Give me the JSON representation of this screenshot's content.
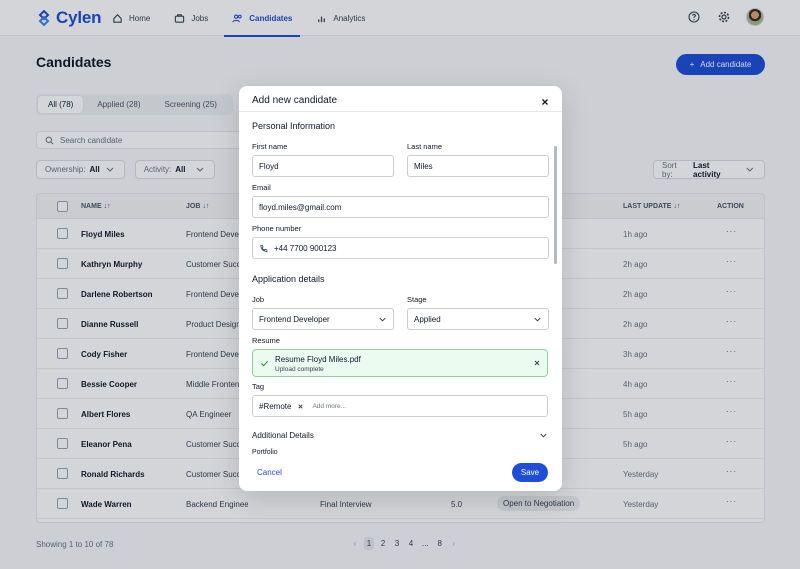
{
  "app": {
    "logo_text": "Cylen"
  },
  "nav": {
    "items": [
      {
        "label": "Home",
        "icon": "home-icon"
      },
      {
        "label": "Jobs",
        "icon": "briefcase-icon"
      },
      {
        "label": "Candidates",
        "icon": "users-icon",
        "active": true
      },
      {
        "label": "Analytics",
        "icon": "bar-chart-icon"
      }
    ]
  },
  "page": {
    "title": "Candidates",
    "add_button": "Add candidate",
    "tabs": [
      "All (78)",
      "Applied (28)",
      "Screening (25)"
    ],
    "search_placeholder": "Search candidate",
    "filters": [
      {
        "label": "Ownership:",
        "value": "All"
      },
      {
        "label": "Activity:",
        "value": "All"
      }
    ],
    "sort_label": "Sort by:",
    "sort_value": "Last activity"
  },
  "table": {
    "columns": {
      "name": "NAME",
      "job": "JOB",
      "last_update": "LAST UPDATE",
      "action": "ACTION"
    },
    "rows": [
      {
        "name": "Floyd Miles",
        "job": "Frontend Developer",
        "stage": "",
        "score": "",
        "status": "",
        "updated": "1h ago"
      },
      {
        "name": "Kathryn Murphy",
        "job": "Customer Success",
        "stage": "",
        "score": "",
        "status": "",
        "updated": "2h ago"
      },
      {
        "name": "Darlene Robertson",
        "job": "Frontend Developer",
        "stage": "",
        "score": "",
        "status": "",
        "updated": "2h ago"
      },
      {
        "name": "Dianne Russell",
        "job": "Product Designer",
        "stage": "",
        "score": "",
        "status": "",
        "updated": "2h ago"
      },
      {
        "name": "Cody Fisher",
        "job": "Frontend Developer",
        "stage": "",
        "score": "",
        "status": "",
        "updated": "3h ago"
      },
      {
        "name": "Bessie Cooper",
        "job": "Middle Frontend",
        "stage": "",
        "score": "",
        "status": "",
        "updated": "4h ago"
      },
      {
        "name": "Albert Flores",
        "job": "QA Engineer",
        "stage": "",
        "score": "",
        "status": "",
        "updated": "5h ago"
      },
      {
        "name": "Eleanor Pena",
        "job": "Customer Success",
        "stage": "",
        "score": "",
        "status": "",
        "updated": "5h ago"
      },
      {
        "name": "Ronald Richards",
        "job": "Customer Success",
        "stage": "",
        "score": "",
        "status": "",
        "updated": "Yesterday"
      },
      {
        "name": "Wade Warren",
        "job": "Backend Engineer",
        "stage": "Final Interview",
        "score": "5.0",
        "status": "Open to Negotiation",
        "updated": "Yesterday"
      }
    ],
    "footer": "Showing 1 to 10 of 78",
    "pages": [
      "1",
      "2",
      "3",
      "4",
      "...",
      "8"
    ]
  },
  "modal": {
    "title": "Add new candidate",
    "personal_section": "Personal Information",
    "first_name_label": "First name",
    "first_name_value": "Floyd",
    "last_name_label": "Last name",
    "last_name_value": "Miles",
    "email_label": "Email",
    "email_value": "floyd.miles@gmail.com",
    "phone_label": "Phone number",
    "phone_value": "+44 7700 900123",
    "application_section": "Application details",
    "job_label": "Job",
    "job_value": "Frontend Developer",
    "stage_label": "Stage",
    "stage_value": "Applied",
    "resume_label": "Resume",
    "resume_file": "Resume Floyd Miles.pdf",
    "resume_status": "Upload complete",
    "tag_label": "Tag",
    "tag_value": "#Remote",
    "tag_placeholder": "Add more...",
    "additional_details": "Additional Details",
    "portfolio_label": "Portfolio",
    "cancel": "Cancel",
    "save": "Save"
  },
  "colors": {
    "brand": "#1e4ed8",
    "success_bg": "#ecfbef",
    "success_border": "#8fd19e"
  }
}
